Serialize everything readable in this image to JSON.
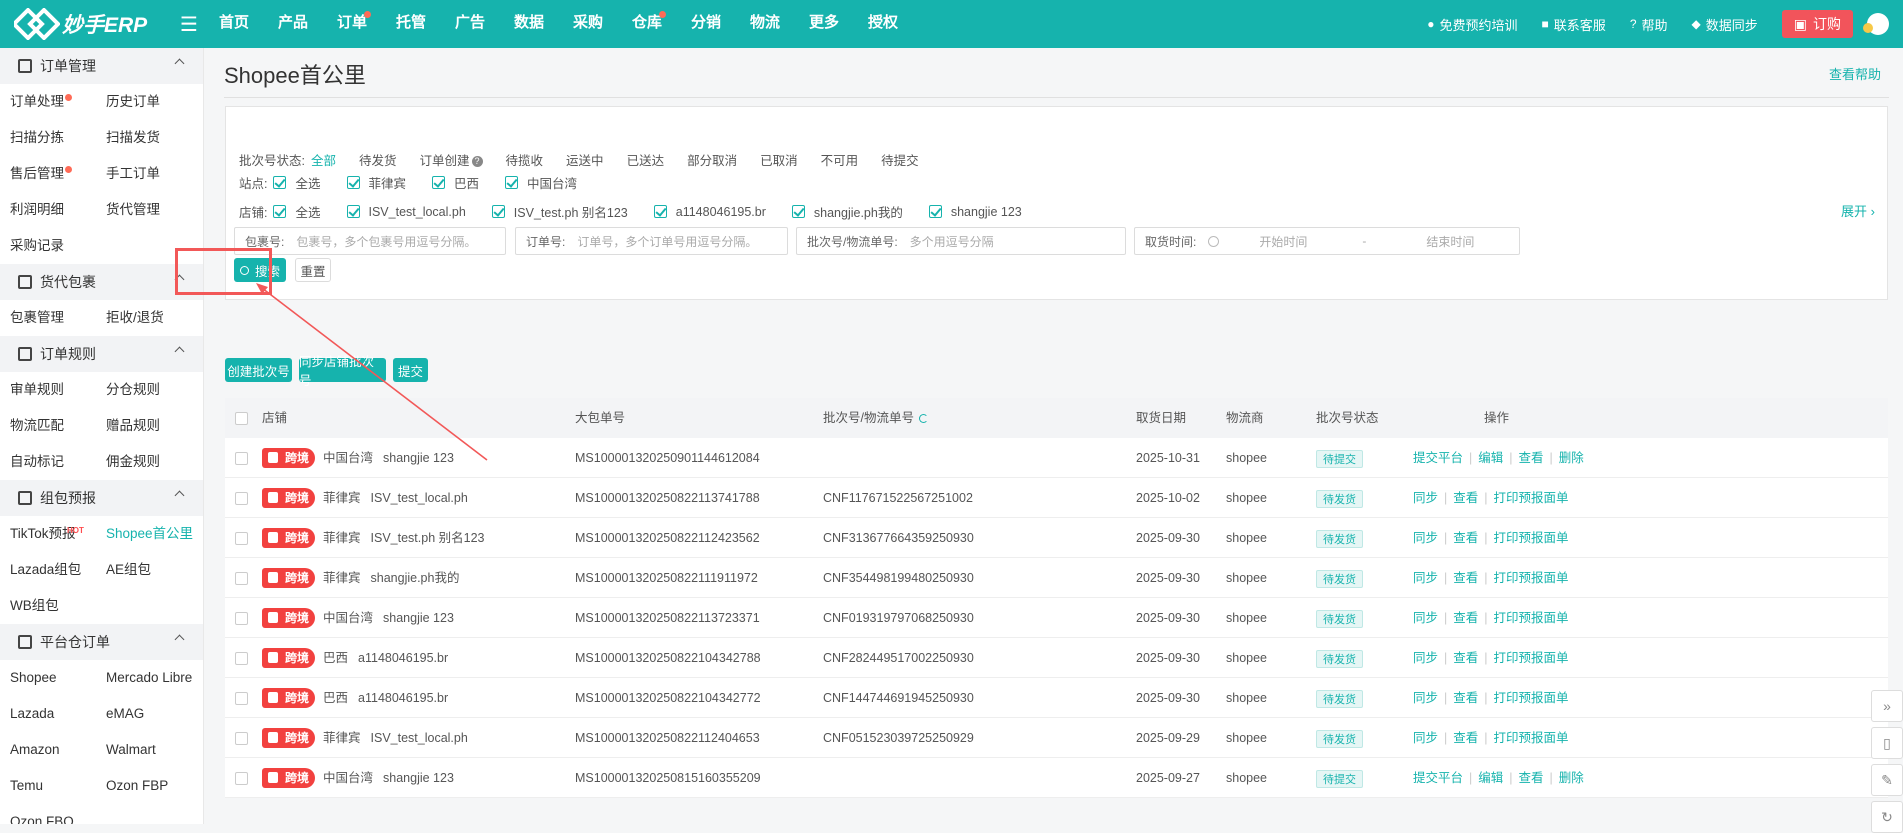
{
  "app": {
    "logo_text": "妙手ERP"
  },
  "nav": [
    {
      "label": "首页",
      "dot": false
    },
    {
      "label": "产品",
      "dot": false
    },
    {
      "label": "订单",
      "dot": true
    },
    {
      "label": "托管",
      "dot": false
    },
    {
      "label": "广告",
      "dot": false
    },
    {
      "label": "数据",
      "dot": false
    },
    {
      "label": "采购",
      "dot": false
    },
    {
      "label": "仓库",
      "dot": true
    },
    {
      "label": "分销",
      "dot": false
    },
    {
      "label": "物流",
      "dot": false
    },
    {
      "label": "更多",
      "dot": false
    },
    {
      "label": "授权",
      "dot": false
    }
  ],
  "topright": {
    "training": "免费预约培训",
    "service": "联系客服",
    "help": "帮助",
    "sync": "数据同步",
    "order": "订购"
  },
  "sidebar": {
    "sections": [
      {
        "title": "订单管理",
        "items": [
          {
            "label": "订单处理",
            "dot": true
          },
          {
            "label": "历史订单"
          },
          {
            "label": "扫描分拣"
          },
          {
            "label": "扫描发货"
          },
          {
            "label": "售后管理",
            "dot": true
          },
          {
            "label": "手工订单"
          },
          {
            "label": "利润明细"
          },
          {
            "label": "货代管理"
          },
          {
            "label": "采购记录"
          }
        ]
      },
      {
        "title": "货代包裹",
        "items": [
          {
            "label": "包裹管理"
          },
          {
            "label": "拒收/退货"
          }
        ]
      },
      {
        "title": "订单规则",
        "items": [
          {
            "label": "审单规则"
          },
          {
            "label": "分仓规则"
          },
          {
            "label": "物流匹配"
          },
          {
            "label": "赠品规则"
          },
          {
            "label": "自动标记"
          },
          {
            "label": "佣金规则"
          }
        ]
      },
      {
        "title": "组包预报",
        "items": [
          {
            "label": "TikTok预报",
            "hot": "HOT"
          },
          {
            "label": "Shopee首公里",
            "active": true
          },
          {
            "label": "Lazada组包"
          },
          {
            "label": "AE组包"
          },
          {
            "label": "WB组包"
          }
        ]
      },
      {
        "title": "平台仓订单",
        "items": [
          {
            "label": "Shopee"
          },
          {
            "label": "Mercado Libre"
          },
          {
            "label": "Lazada"
          },
          {
            "label": "eMAG"
          },
          {
            "label": "Amazon"
          },
          {
            "label": "Walmart"
          },
          {
            "label": "Temu"
          },
          {
            "label": "Ozon FBP"
          },
          {
            "label": "Ozon FBO"
          }
        ]
      }
    ]
  },
  "page": {
    "title": "Shopee首公里",
    "help": "查看帮助"
  },
  "filters": {
    "status_label": "批次号状态:",
    "status_options": [
      "全部",
      "待发货",
      "订单创建",
      "待揽收",
      "运送中",
      "已送达",
      "部分取消",
      "已取消",
      "不可用",
      "待提交"
    ],
    "site_label": "站点:",
    "sites": [
      "全选",
      "菲律宾",
      "巴西",
      "中国台湾"
    ],
    "shop_label": "店铺:",
    "shops": [
      "全选",
      "ISV_test_local.ph",
      "ISV_test.ph 别名123",
      "a1148046195.br",
      "shangjie.ph我的",
      "shangjie 123"
    ],
    "expand": "展开",
    "package_label": "包裹号:",
    "package_placeholder": "包裹号，多个包裹号用逗号分隔。",
    "order_label": "订单号:",
    "order_placeholder": "订单号，多个订单号用逗号分隔。",
    "batch_label": "批次号/物流单号:",
    "batch_placeholder": "多个用逗号分隔",
    "time_label": "取货时间:",
    "start_placeholder": "开始时间",
    "dash": "-",
    "end_placeholder": "结束时间",
    "search": "搜索",
    "reset": "重置"
  },
  "actions": {
    "create": "创建批次号",
    "sync": "同步店铺批次号",
    "submit": "提交"
  },
  "table": {
    "headers": {
      "shop": "店铺",
      "package": "大包单号",
      "batch": "批次号/物流单号",
      "date": "取货日期",
      "carrier": "物流商",
      "status": "批次号状态",
      "ops": "操作"
    },
    "tag": "跨境",
    "rows": [
      {
        "site": "中国台湾",
        "shop": "shangjie 123",
        "package": "MS100001320250901144612084",
        "batch": "",
        "date": "2025-10-31",
        "carrier": "shopee",
        "status": "待提交",
        "ops": [
          "提交平台",
          "编辑",
          "查看",
          "删除"
        ]
      },
      {
        "site": "菲律宾",
        "shop": "ISV_test_local.ph",
        "package": "MS100001320250822113741788",
        "batch": "CNF117671522567251002",
        "date": "2025-10-02",
        "carrier": "shopee",
        "status": "待发货",
        "ops": [
          "同步",
          "查看",
          "打印预报面单"
        ]
      },
      {
        "site": "菲律宾",
        "shop": "ISV_test.ph 别名123",
        "package": "MS100001320250822112423562",
        "batch": "CNF313677664359250930",
        "date": "2025-09-30",
        "carrier": "shopee",
        "status": "待发货",
        "ops": [
          "同步",
          "查看",
          "打印预报面单"
        ]
      },
      {
        "site": "菲律宾",
        "shop": "shangjie.ph我的",
        "package": "MS100001320250822111911972",
        "batch": "CNF354498199480250930",
        "date": "2025-09-30",
        "carrier": "shopee",
        "status": "待发货",
        "ops": [
          "同步",
          "查看",
          "打印预报面单"
        ]
      },
      {
        "site": "中国台湾",
        "shop": "shangjie 123",
        "package": "MS100001320250822113723371",
        "batch": "CNF019319797068250930",
        "date": "2025-09-30",
        "carrier": "shopee",
        "status": "待发货",
        "ops": [
          "同步",
          "查看",
          "打印预报面单"
        ]
      },
      {
        "site": "巴西",
        "shop": "a1148046195.br",
        "package": "MS100001320250822104342788",
        "batch": "CNF282449517002250930",
        "date": "2025-09-30",
        "carrier": "shopee",
        "status": "待发货",
        "ops": [
          "同步",
          "查看",
          "打印预报面单"
        ]
      },
      {
        "site": "巴西",
        "shop": "a1148046195.br",
        "package": "MS100001320250822104342772",
        "batch": "CNF144744691945250930",
        "date": "2025-09-30",
        "carrier": "shopee",
        "status": "待发货",
        "ops": [
          "同步",
          "查看",
          "打印预报面单"
        ]
      },
      {
        "site": "菲律宾",
        "shop": "ISV_test_local.ph",
        "package": "MS100001320250822112404653",
        "batch": "CNF051523039725250929",
        "date": "2025-09-29",
        "carrier": "shopee",
        "status": "待发货",
        "ops": [
          "同步",
          "查看",
          "打印预报面单"
        ]
      },
      {
        "site": "中国台湾",
        "shop": "shangjie 123",
        "package": "MS100001320250815160355209",
        "batch": "",
        "date": "2025-09-27",
        "carrier": "shopee",
        "status": "待提交",
        "ops": [
          "提交平台",
          "编辑",
          "查看",
          "删除"
        ]
      }
    ]
  },
  "colors": {
    "brand": "#16b3ad",
    "alert": "#f2413f",
    "highlight": "#f25858"
  }
}
